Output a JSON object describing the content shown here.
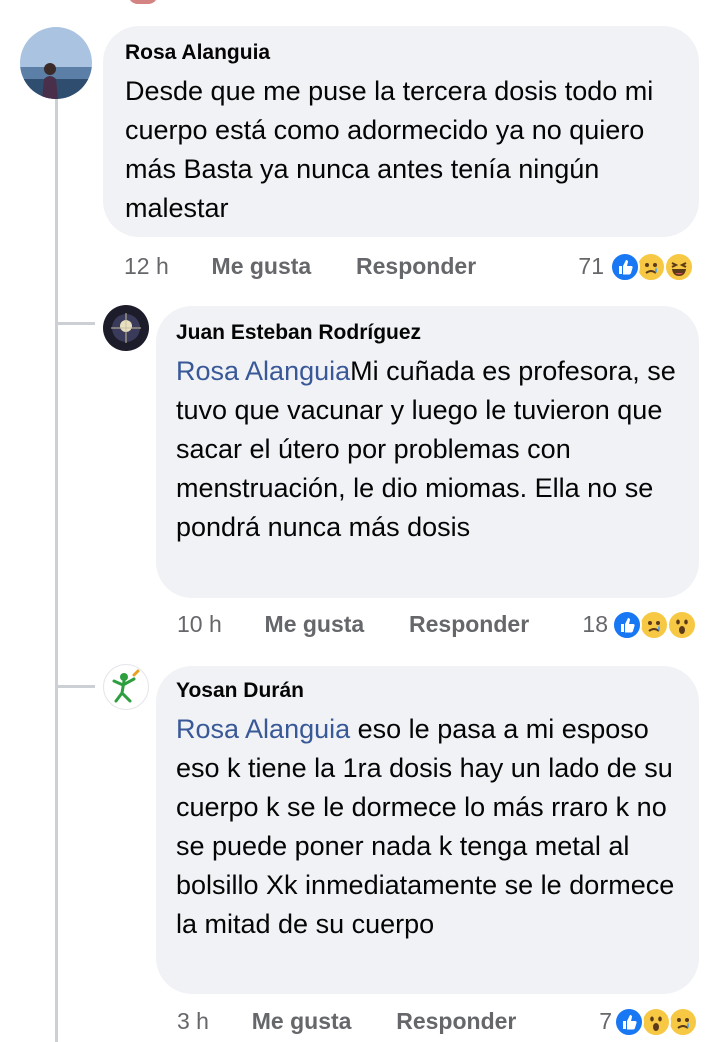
{
  "comments": [
    {
      "author": "Rosa Alanguia",
      "mention": "",
      "text": "Desde que me puse la tercera dosis todo mi cuerpo está como adormecido ya no quiero más Basta ya nunca antes tenía ningún malestar",
      "time": "12 h",
      "like_label": "Me gusta",
      "reply_label": "Responder",
      "reaction_count": "71",
      "reactions": [
        "like-icon",
        "sad-icon",
        "haha-icon"
      ]
    },
    {
      "author": "Juan Esteban Rodríguez",
      "mention": "Rosa Alanguia",
      "text": "Mi cuñada es profesora, se tuvo que vacunar y luego le tuvieron que sacar el útero por problemas con menstruación, le dio miomas. Ella no se pondrá nunca más dosis",
      "time": "10 h",
      "like_label": "Me gusta",
      "reply_label": "Responder",
      "reaction_count": "18",
      "reactions": [
        "like-icon",
        "sad-icon",
        "wow-icon"
      ]
    },
    {
      "author": "Yosan Durán",
      "mention": "Rosa Alanguia",
      "text": " eso le pasa a mi esposo eso k tiene la 1ra dosis hay un lado de su cuerpo k se le dormece lo más rraro k no se puede poner nada k tenga metal al bolsillo Xk inmediatamente se le dormece la mitad de su cuerpo",
      "time": "3 h",
      "like_label": "Me gusta",
      "reply_label": "Responder",
      "reaction_count": "7",
      "reactions": [
        "like-icon",
        "wow-icon",
        "sad-icon"
      ]
    }
  ],
  "colors": {
    "bubble": "#f0f2f5",
    "mention": "#385898",
    "meta": "#65676b",
    "like": "#1877f2"
  }
}
